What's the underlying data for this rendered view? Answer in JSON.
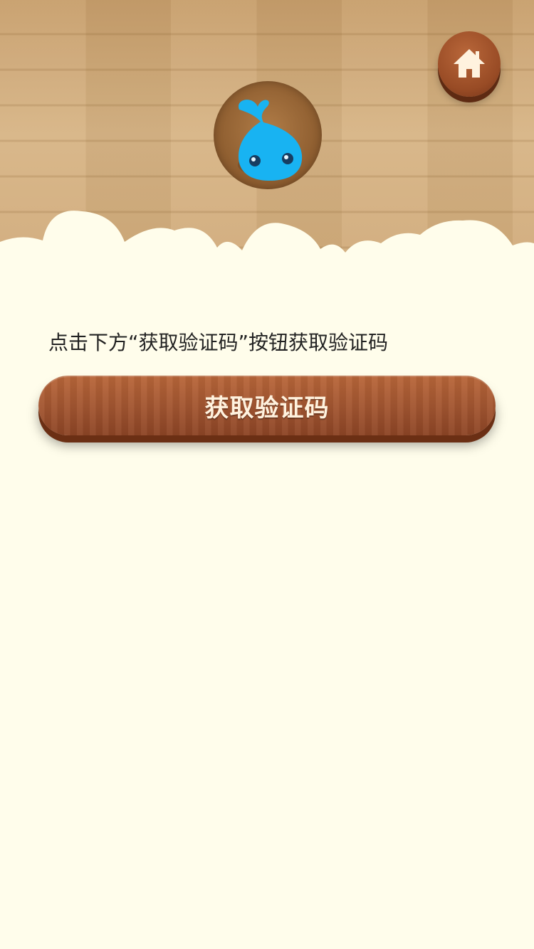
{
  "instruction": "点击下方“获取验证码”按钮获取验证码",
  "verify_button_label": "获取验证码",
  "icons": {
    "home": "home-icon",
    "logo": "water-drop-mascot-icon"
  },
  "colors": {
    "page_background": "#fffdeb",
    "wood": "#a35631",
    "mascot": "#18b3f2"
  }
}
